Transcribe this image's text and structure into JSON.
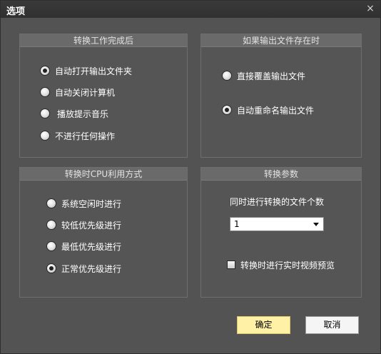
{
  "window": {
    "title": "选项",
    "close_glyph": "×"
  },
  "groups": {
    "completion": {
      "header": "转换工作完成后",
      "options": [
        {
          "label": "自动打开输出文件夹",
          "checked": true
        },
        {
          "label": "自动关闭计算机",
          "checked": false
        },
        {
          "label": "播放提示音乐",
          "checked": false
        },
        {
          "label": "不进行任何操作",
          "checked": false
        }
      ]
    },
    "exists": {
      "header": "如果输出文件存在时",
      "options": [
        {
          "label": "直接覆盖输出文件",
          "checked": false
        },
        {
          "label": "自动重命名输出文件",
          "checked": true
        }
      ]
    },
    "cpu": {
      "header": "转换时CPU利用方式",
      "options": [
        {
          "label": "系统空闲时进行",
          "checked": false
        },
        {
          "label": "较低优先级进行",
          "checked": false
        },
        {
          "label": "最低优先级进行",
          "checked": false
        },
        {
          "label": "正常优先级进行",
          "checked": true
        }
      ]
    },
    "params": {
      "header": "转换参数",
      "count_label": "同时进行转换的文件个数",
      "count_value": "1",
      "preview_label": "转换时进行实时视频预览",
      "preview_checked": false
    }
  },
  "buttons": {
    "ok": "确定",
    "cancel": "取消"
  }
}
